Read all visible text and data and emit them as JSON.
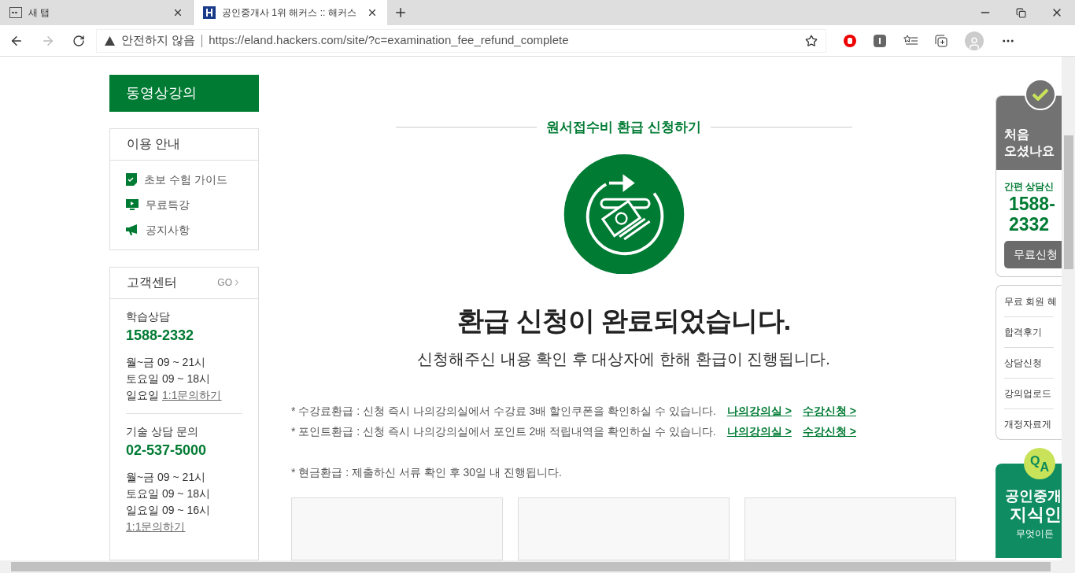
{
  "browser": {
    "tabs": [
      {
        "title": "새 탭",
        "selected": false
      },
      {
        "title": "공인중개사 1위 해커스 :: 해커스",
        "selected": true
      }
    ],
    "address": {
      "warning": "안전하지 않음",
      "url": "https://eland.hackers.com/site/?c=examination_fee_refund_complete"
    }
  },
  "sidebar": {
    "header": "동영상강의",
    "guide": {
      "title": "이용 안내",
      "items": [
        {
          "label": "초보 수험 가이드",
          "kind": "check"
        },
        {
          "label": "무료특강",
          "kind": "video"
        },
        {
          "label": "공지사항",
          "kind": "megaphone"
        }
      ]
    },
    "support": {
      "title": "고객센터",
      "go": "GO",
      "sections": [
        {
          "title": "학습상담",
          "phone": "1588-2332",
          "lines": [
            "월~금 09 ~ 21시",
            "토요일 09 ~ 18시"
          ],
          "last": "일요일",
          "link": "1:1문의하기"
        },
        {
          "title": "기술 상담 문의",
          "phone": "02-537-5000",
          "lines": [
            "월~금 09 ~ 21시",
            "토요일 09 ~ 18시",
            "일요일 09 ~ 16시"
          ],
          "link": "1:1문의하기"
        }
      ]
    }
  },
  "main": {
    "section_title": "원서접수비 환급 신청하기",
    "headline": "환급 신청이 완료되었습니다.",
    "subtitle": "신청해주신 내용 확인 후 대상자에 한해 환급이 진행됩니다.",
    "notes": [
      {
        "text": "* 수강료환급 : 신청 즉시 나의강의실에서 수강료 3배 할인쿠폰을 확인하실 수 있습니다.",
        "links": [
          "나의강의실 >",
          "수강신청 >"
        ]
      },
      {
        "text": "* 포인트환급 : 신청 즉시 나의강의실에서 포인트 2배 적립내역을 확인하실 수 있습니다.",
        "links": [
          "나의강의실 >",
          "수강신청 >"
        ]
      },
      {
        "text": "* 현금환급 : 제출하신 서류 확인 후 30일 내 진행됩니다."
      }
    ]
  },
  "right_panel": {
    "promo_title": [
      "처음",
      "오셨나요"
    ],
    "consult_label": "간편 상담신",
    "phone": [
      "1588-",
      "2332"
    ],
    "button": "무료신청",
    "menu": [
      "무료 회원 혜",
      "합격후기",
      "상담신청",
      "강의업로드",
      "개정자료게"
    ],
    "qa_badge": [
      "Q",
      "A"
    ],
    "qa_title": [
      "공인중개",
      "지식인"
    ],
    "qa_sub": "무엇이든"
  }
}
